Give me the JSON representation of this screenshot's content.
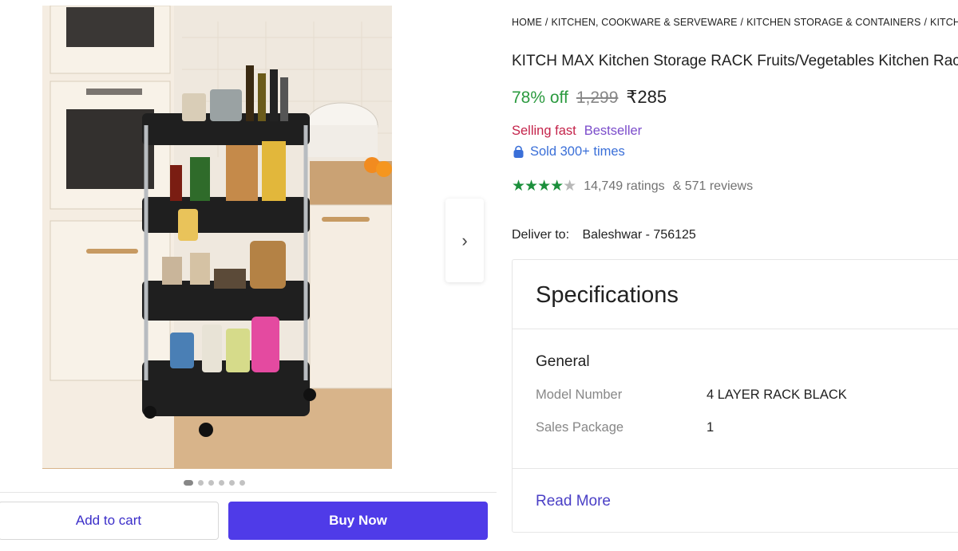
{
  "breadcrumb": {
    "items": [
      "HOME",
      "KITCHEN, COOKWARE & SERVEWARE",
      "KITCHEN STORAGE & CONTAINERS",
      "KITCHEN RACKS"
    ],
    "separator": "/"
  },
  "product": {
    "title": "KITCH MAX Kitchen Storage RACK Fruits/Vegetables Kitchen Rack",
    "discount": "78% off",
    "mrp": "1,299",
    "price": "₹285",
    "selling_fast": "Selling fast",
    "bestseller": "Bestseller",
    "sold": "Sold 300+ times",
    "rating_stars": 4.5,
    "ratings": "14,749 ratings",
    "reviews": "& 571 reviews"
  },
  "delivery": {
    "label": "Deliver to:",
    "location": "Baleshwar - 756125"
  },
  "gallery": {
    "total_images": 6,
    "active_index": 0,
    "next_icon": "chevron-right-icon"
  },
  "actions": {
    "add_to_cart": "Add to cart",
    "buy_now": "Buy Now"
  },
  "specifications": {
    "title": "Specifications",
    "group": "General",
    "rows": [
      {
        "key": "Model Number",
        "value": "4 LAYER RACK BLACK"
      },
      {
        "key": "Sales Package",
        "value": "1"
      }
    ],
    "read_more": "Read More"
  },
  "colors": {
    "discount": "#2b9a3f",
    "buy_now": "#4f3be8",
    "selling_fast": "#c4234a",
    "bestseller": "#7b4ccb",
    "sold": "#3a6fd8",
    "stars": "#1b8f3b",
    "read_more": "#4a3fc6"
  }
}
